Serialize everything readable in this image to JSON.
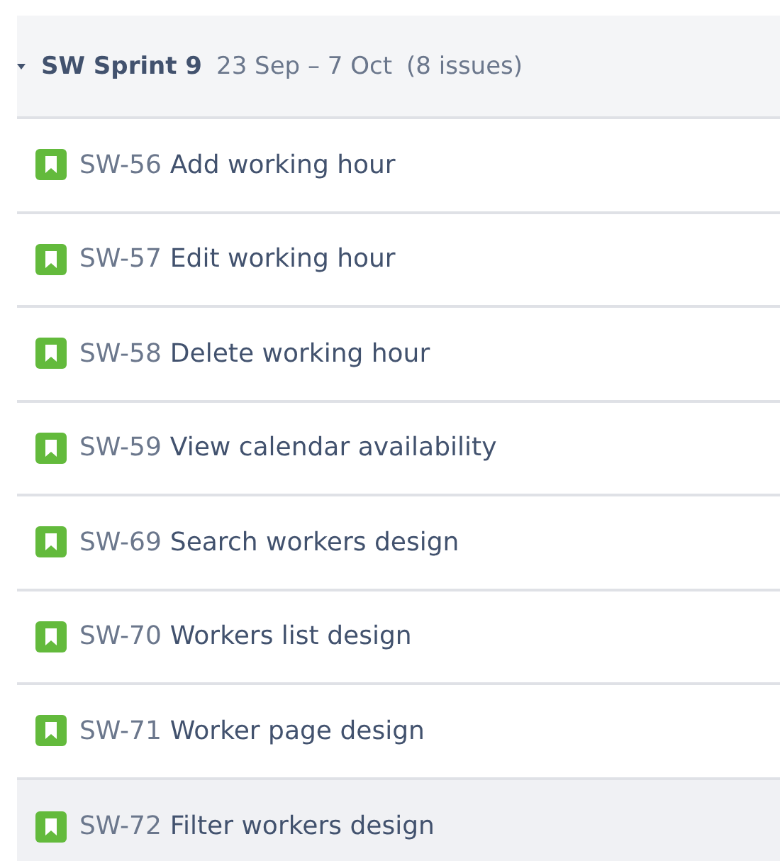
{
  "sprint": {
    "name": "SW Sprint 9",
    "dates": "23 Sep – 7 Oct",
    "count": "(8 issues)",
    "expanded": true
  },
  "issues": [
    {
      "key": "SW-56",
      "summary": "Add working hour",
      "selected": false
    },
    {
      "key": "SW-57",
      "summary": "Edit working hour",
      "selected": false
    },
    {
      "key": "SW-58",
      "summary": "Delete working hour",
      "selected": false
    },
    {
      "key": "SW-59",
      "summary": "View calendar availability",
      "selected": false
    },
    {
      "key": "SW-69",
      "summary": "Search workers design",
      "selected": false
    },
    {
      "key": "SW-70",
      "summary": "Workers list design",
      "selected": false
    },
    {
      "key": "SW-71",
      "summary": "Worker page design",
      "selected": false
    },
    {
      "key": "SW-72",
      "summary": "Filter workers design",
      "selected": true
    }
  ]
}
